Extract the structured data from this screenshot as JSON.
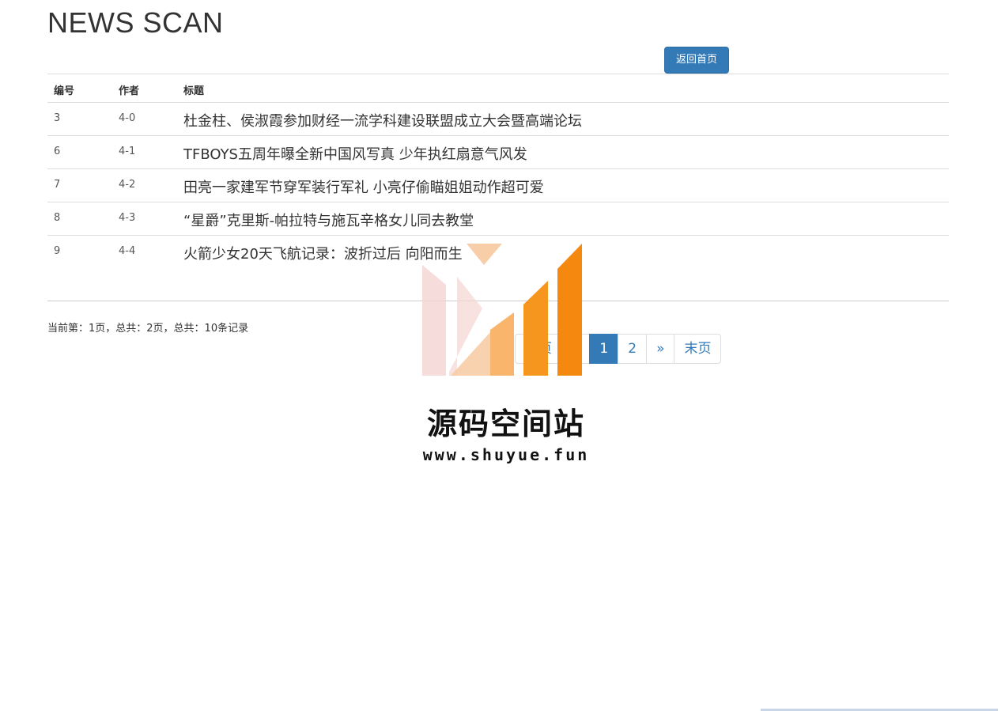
{
  "page": {
    "title": "NEWS SCAN"
  },
  "toolbar": {
    "home_button": "返回首页"
  },
  "table": {
    "columns": [
      "编号",
      "作者",
      "标题"
    ],
    "rows": [
      {
        "id": "3",
        "author": "4-0",
        "title": "杜金柱、侯淑霞参加财经一流学科建设联盟成立大会暨高端论坛"
      },
      {
        "id": "6",
        "author": "4-1",
        "title": "TFBOYS五周年曝全新中国风写真 少年执红扇意气风发"
      },
      {
        "id": "7",
        "author": "4-2",
        "title": "田亮一家建军节穿军装行军礼 小亮仔偷瞄姐姐动作超可爱"
      },
      {
        "id": "8",
        "author": "4-3",
        "title": "“星爵”克里斯-帕拉特与施瓦辛格女儿同去教堂"
      },
      {
        "id": "9",
        "author": "4-4",
        "title": "火箭少女20天飞航记录：波折过后 向阳而生"
      }
    ]
  },
  "pagination": {
    "status": "当前第：1页，总共：2页，总共：10条记录",
    "first": "首页",
    "prev": "«",
    "current": "1",
    "next_page": "2",
    "next": "»",
    "last": "末页"
  },
  "watermark": {
    "title": "源码空间站",
    "url": "www.shuyue.fun"
  },
  "colors": {
    "primary": "#337ab7",
    "border": "#dddddd",
    "text": "#333333",
    "watermark_orange": "#f5890f"
  }
}
